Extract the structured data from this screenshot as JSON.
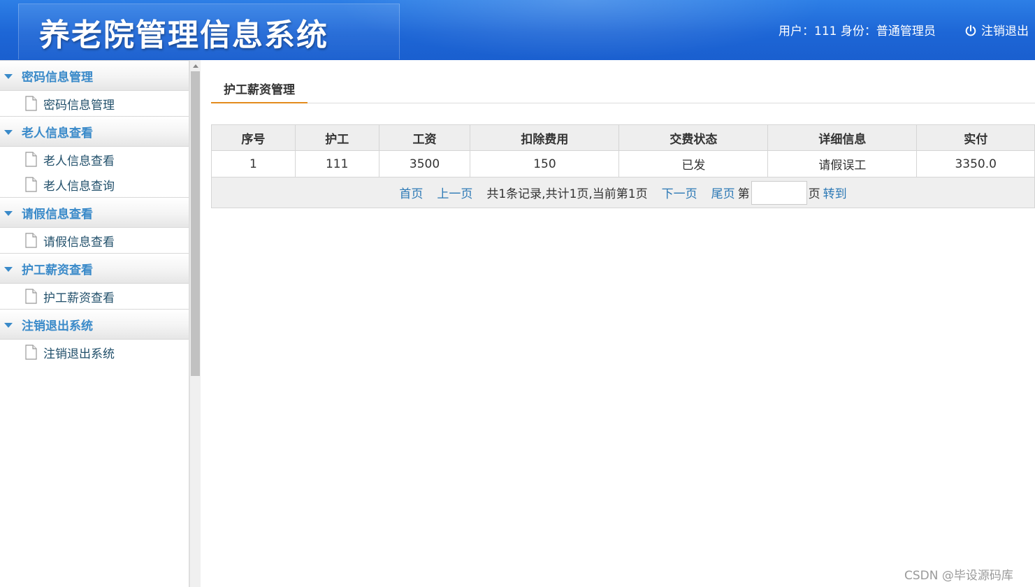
{
  "header": {
    "title": "养老院管理信息系统",
    "user_info": "用户：111 身份：普通管理员",
    "logout_label": "注销退出"
  },
  "sidebar": {
    "groups": [
      {
        "label": "密码信息管理",
        "items": [
          {
            "label": "密码信息管理"
          }
        ]
      },
      {
        "label": "老人信息查看",
        "items": [
          {
            "label": "老人信息查看"
          },
          {
            "label": "老人信息查询"
          }
        ]
      },
      {
        "label": "请假信息查看",
        "items": [
          {
            "label": "请假信息查看"
          }
        ]
      },
      {
        "label": "护工薪资查看",
        "items": [
          {
            "label": "护工薪资查看"
          }
        ]
      },
      {
        "label": "注销退出系统",
        "items": [
          {
            "label": "注销退出系统"
          }
        ]
      }
    ]
  },
  "main": {
    "tab_label": "护工薪资管理",
    "table": {
      "columns": [
        "序号",
        "护工",
        "工资",
        "扣除费用",
        "交费状态",
        "详细信息",
        "实付"
      ],
      "rows": [
        [
          "1",
          "111",
          "3500",
          "150",
          "已发",
          "请假误工",
          "3350.0"
        ]
      ]
    },
    "pager": {
      "first": "首页",
      "prev": "上一页",
      "summary": "共1条记录,共计1页,当前第1页",
      "next": "下一页",
      "last": "尾页",
      "page_prefix": "第",
      "page_suffix": "页",
      "goto": "转到",
      "page_input_value": ""
    }
  },
  "watermark": "CSDN @毕设源码库",
  "colors": {
    "header_blue": "#1d66d6",
    "sidebar_accent": "#3a8ac9",
    "link_blue": "#2b78b5",
    "tab_underline": "#e38b1d"
  }
}
